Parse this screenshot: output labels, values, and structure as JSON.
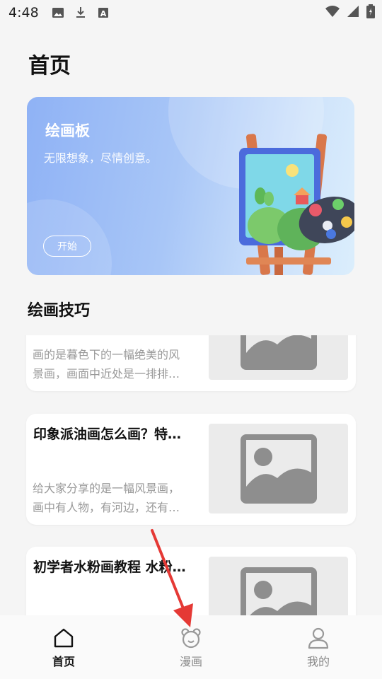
{
  "status_bar": {
    "time": "4:48",
    "left_icons": [
      "image-icon",
      "download-icon",
      "font-icon"
    ],
    "right_icons": [
      "wifi-icon",
      "signal-icon",
      "battery-icon"
    ]
  },
  "header": {
    "title": "首页"
  },
  "banner": {
    "title": "绘画板",
    "subtitle": "无限想象，尽情创意。",
    "button_label": "开始"
  },
  "section": {
    "title": "绘画技巧"
  },
  "articles": [
    {
      "title": "",
      "desc_line1": "画的是暮色下的一幅绝美的风",
      "desc_line2": "景画，画面中近处是一排排…"
    },
    {
      "title": "印象派油画怎么画？特…",
      "desc_line1": "给大家分享的是一幅风景画，",
      "desc_line2": "画中有人物，有河边，还有…"
    },
    {
      "title": "初学者水粉画教程 水粉…",
      "desc_line1": "",
      "desc_line2": ""
    }
  ],
  "bottom_nav": [
    {
      "label": "首页",
      "icon": "home-icon",
      "active": true
    },
    {
      "label": "漫画",
      "icon": "bear-icon",
      "active": false
    },
    {
      "label": "我的",
      "icon": "user-icon",
      "active": false
    }
  ],
  "colors": {
    "accent": "#111111",
    "inactive": "#888888",
    "banner_start": "#8fb2f5",
    "banner_end": "#dbeefc",
    "annotation": "#e53935"
  }
}
